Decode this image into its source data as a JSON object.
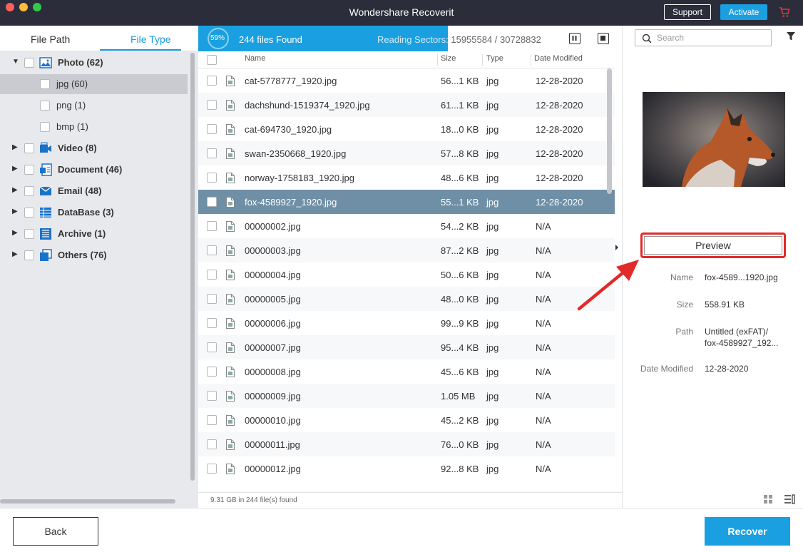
{
  "window": {
    "title": "Wondershare Recoverit",
    "support_label": "Support",
    "activate_label": "Activate"
  },
  "sidebar": {
    "tabs": [
      "File Path",
      "File Type"
    ],
    "active_tab": "File Type",
    "items": [
      {
        "label": "Photo (62)",
        "icon": "photo-icon"
      },
      {
        "label": "jpg (60)"
      },
      {
        "label": "png (1)"
      },
      {
        "label": "bmp (1)"
      },
      {
        "label": "Video (8)",
        "icon": "video-icon"
      },
      {
        "label": "Document (46)",
        "icon": "document-icon"
      },
      {
        "label": "Email (48)",
        "icon": "email-icon"
      },
      {
        "label": "DataBase (3)",
        "icon": "database-icon"
      },
      {
        "label": "Archive (1)",
        "icon": "archive-icon"
      },
      {
        "label": "Others (76)",
        "icon": "others-icon"
      }
    ]
  },
  "scan": {
    "percent_label": "59%",
    "progress": 0.59,
    "files_found": "244 files Found",
    "reading_label": "Reading Sectors:",
    "reading_value": "15955584 / 30728832"
  },
  "table": {
    "headers": {
      "name": "Name",
      "size": "Size",
      "type": "Type",
      "date": "Date Modified"
    },
    "rows": [
      {
        "name": "cat-5778777_1920.jpg",
        "size": "56...1 KB",
        "type": "jpg",
        "date": "12-28-2020"
      },
      {
        "name": "dachshund-1519374_1920.jpg",
        "size": "61...1 KB",
        "type": "jpg",
        "date": "12-28-2020"
      },
      {
        "name": "cat-694730_1920.jpg",
        "size": "18...0 KB",
        "type": "jpg",
        "date": "12-28-2020"
      },
      {
        "name": "swan-2350668_1920.jpg",
        "size": "57...8 KB",
        "type": "jpg",
        "date": "12-28-2020"
      },
      {
        "name": "norway-1758183_1920.jpg",
        "size": "48...6 KB",
        "type": "jpg",
        "date": "12-28-2020"
      },
      {
        "name": "fox-4589927_1920.jpg",
        "size": "55...1 KB",
        "type": "jpg",
        "date": "12-28-2020"
      },
      {
        "name": "00000002.jpg",
        "size": "54...2 KB",
        "type": "jpg",
        "date": "N/A"
      },
      {
        "name": "00000003.jpg",
        "size": "87...2 KB",
        "type": "jpg",
        "date": "N/A"
      },
      {
        "name": "00000004.jpg",
        "size": "50...6 KB",
        "type": "jpg",
        "date": "N/A"
      },
      {
        "name": "00000005.jpg",
        "size": "48...0 KB",
        "type": "jpg",
        "date": "N/A"
      },
      {
        "name": "00000006.jpg",
        "size": "99...9 KB",
        "type": "jpg",
        "date": "N/A"
      },
      {
        "name": "00000007.jpg",
        "size": "95...4 KB",
        "type": "jpg",
        "date": "N/A"
      },
      {
        "name": "00000008.jpg",
        "size": "45...6 KB",
        "type": "jpg",
        "date": "N/A"
      },
      {
        "name": "00000009.jpg",
        "size": "1.05 MB",
        "type": "jpg",
        "date": "N/A"
      },
      {
        "name": "00000010.jpg",
        "size": "45...2 KB",
        "type": "jpg",
        "date": "N/A"
      },
      {
        "name": "00000011.jpg",
        "size": "76...0 KB",
        "type": "jpg",
        "date": "N/A"
      },
      {
        "name": "00000012.jpg",
        "size": "92...8 KB",
        "type": "jpg",
        "date": "N/A"
      }
    ],
    "status": "9.31 GB in 244 file(s) found"
  },
  "preview": {
    "search_placeholder": "Search",
    "preview_button": "Preview",
    "name_label": "Name",
    "name_value": "fox-4589...1920.jpg",
    "size_label": "Size",
    "size_value": "558.91 KB",
    "path_label": "Path",
    "path_value_1": "Untitled (exFAT)/",
    "path_value_2": "fox-4589927_192...",
    "date_label": "Date Modified",
    "date_value": "12-28-2020"
  },
  "footer": {
    "back_label": "Back",
    "recover_label": "Recover"
  },
  "colors": {
    "accent": "#1aa0e0",
    "titlebar": "#2b2d3a",
    "selected_row": "#6e8fa6",
    "highlight": "#e12a2a"
  }
}
